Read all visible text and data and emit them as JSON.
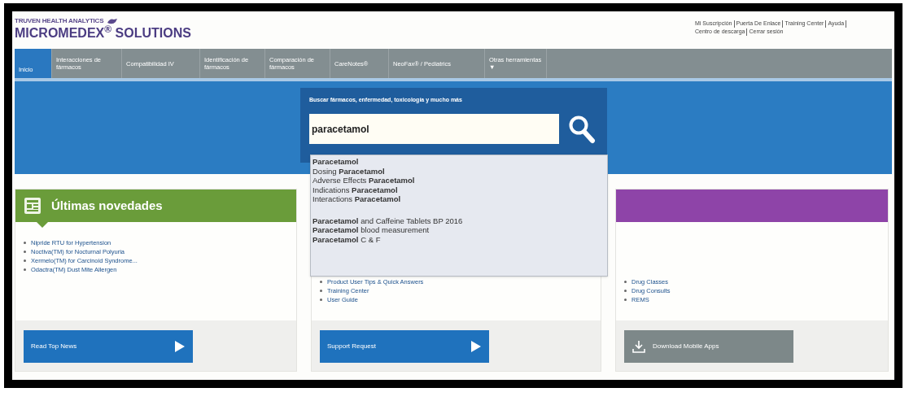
{
  "brand": {
    "company": "TRUVEN HEALTH ANALYTICS",
    "product": "MICROMEDEX$^{®}$ SOLUTIONS"
  },
  "top_links": [
    "Mi Suscripción",
    "Puerta De Enlace",
    "Training Center",
    "Ayuda",
    "Centro de descarga",
    "Cerrar sesión"
  ],
  "tabs": [
    {
      "label": "Inicio",
      "selected": true
    },
    {
      "label": "Interacciones de fármacos",
      "selected": false
    },
    {
      "label": "Compatibilidad IV",
      "selected": false
    },
    {
      "label": "Identificación de fármacos",
      "selected": false
    },
    {
      "label": "Comparación de fármacos",
      "selected": false
    },
    {
      "label": "CareNotes®",
      "selected": false
    },
    {
      "label": "NeoFax® / Pediatrics",
      "selected": false
    },
    {
      "label": "Otras herramientas ▼",
      "selected": false
    }
  ],
  "search": {
    "label": "Buscar fármacos, enfermedad, toxicología y mucho más",
    "value": "paracetamol"
  },
  "suggestion_groups": [
    {
      "items": [
        {
          "kind": "phrase",
          "text": "**Paracetamol**"
        },
        {
          "kind": "phrase",
          "text": "Dosing **Paracetamol**"
        },
        {
          "kind": "phrase",
          "text": "Adverse Effects **Paracetamol**"
        },
        {
          "kind": "phrase",
          "text": "Indications **Paracetamol**"
        },
        {
          "kind": "phrase",
          "text": "Interactions **Paracetamol**"
        }
      ]
    },
    {
      "items": [
        {
          "kind": "phrase",
          "text": "**Paracetamol** and Caffeine Tablets BP 2016"
        },
        {
          "kind": "phrase",
          "text": "**Paracetamol** blood measurement"
        },
        {
          "kind": "phrase",
          "text": "**Paracetamol** C & F"
        }
      ]
    }
  ],
  "cards": [
    {
      "kind": "news",
      "title": "Últimas novedades",
      "items": [
        "Nipride RTU for Hypertension",
        "Noctiva(TM) for Nocturnal Polyuria",
        "Xermelo(TM) for Carcinoid Syndrome...",
        "Odactra(TM) Dust Mite Allergen"
      ],
      "button": "Read Top News"
    },
    {
      "kind": "support",
      "items": [
        "Product User Tips & Quick Answers",
        "Training Center",
        "User Guide"
      ],
      "button": "Support Request"
    },
    {
      "kind": "apps",
      "items": [
        "Drug Classes",
        "Drug Consults",
        "REMS"
      ],
      "button": "Download Mobile Apps"
    }
  ]
}
